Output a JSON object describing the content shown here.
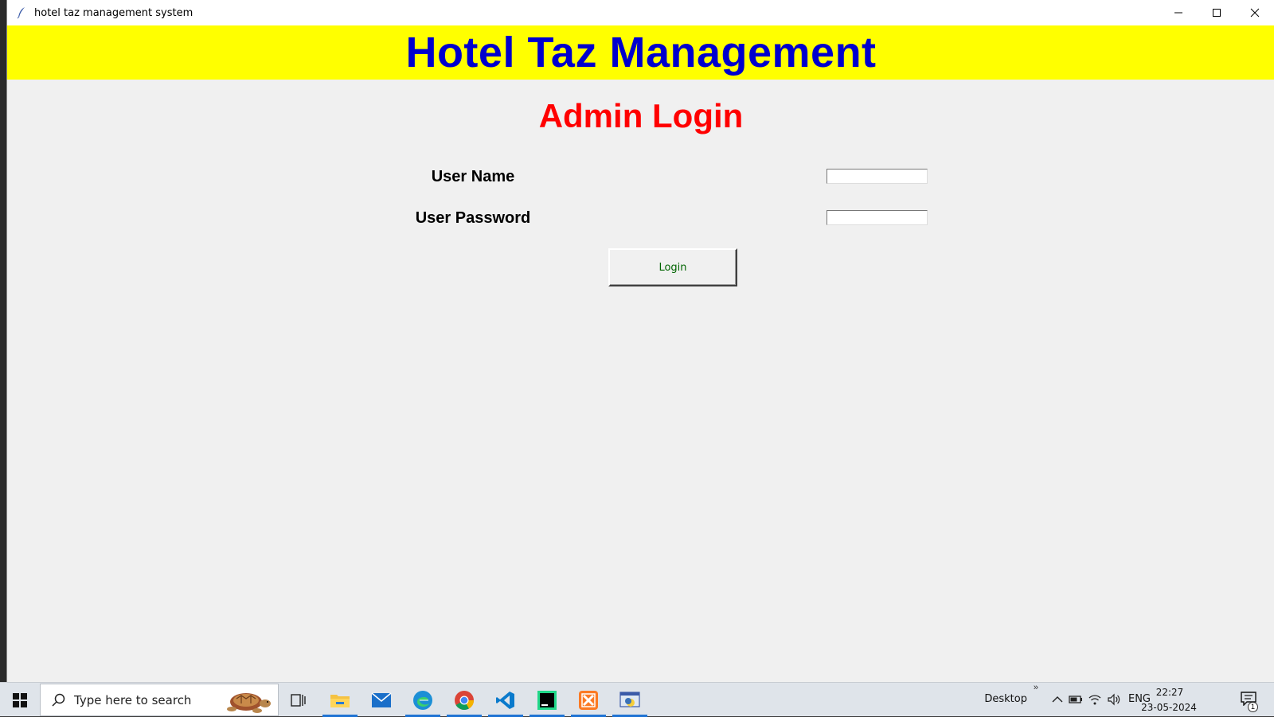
{
  "window": {
    "title": "hotel taz management system"
  },
  "app": {
    "heading": "Hotel Taz Management",
    "heading_color": "#0000cd",
    "header_background": "#ffff00",
    "login_heading": "Admin Login",
    "login_heading_color": "#ff0000"
  },
  "form": {
    "username_label": "User Name",
    "username_value": "",
    "password_label": "User Password",
    "password_value": "",
    "login_button": "Login",
    "login_button_color": "#006400"
  },
  "taskbar": {
    "search_placeholder": "Type here to search",
    "pinned": [
      {
        "icon": "task-view-icon",
        "active": false
      },
      {
        "icon": "file-explorer-icon",
        "active": true
      },
      {
        "icon": "mail-icon",
        "active": false
      },
      {
        "icon": "edge-icon",
        "active": true
      },
      {
        "icon": "chrome-icon",
        "active": true
      },
      {
        "icon": "vscode-icon",
        "active": true
      },
      {
        "icon": "pycharm-icon",
        "active": true
      },
      {
        "icon": "xampp-icon",
        "active": true
      },
      {
        "icon": "python-tk-icon",
        "active": true
      }
    ],
    "desktop_label": "Desktop",
    "language": "ENG",
    "time": "22:27",
    "date": "23-05-2024",
    "notification_count": "1"
  }
}
